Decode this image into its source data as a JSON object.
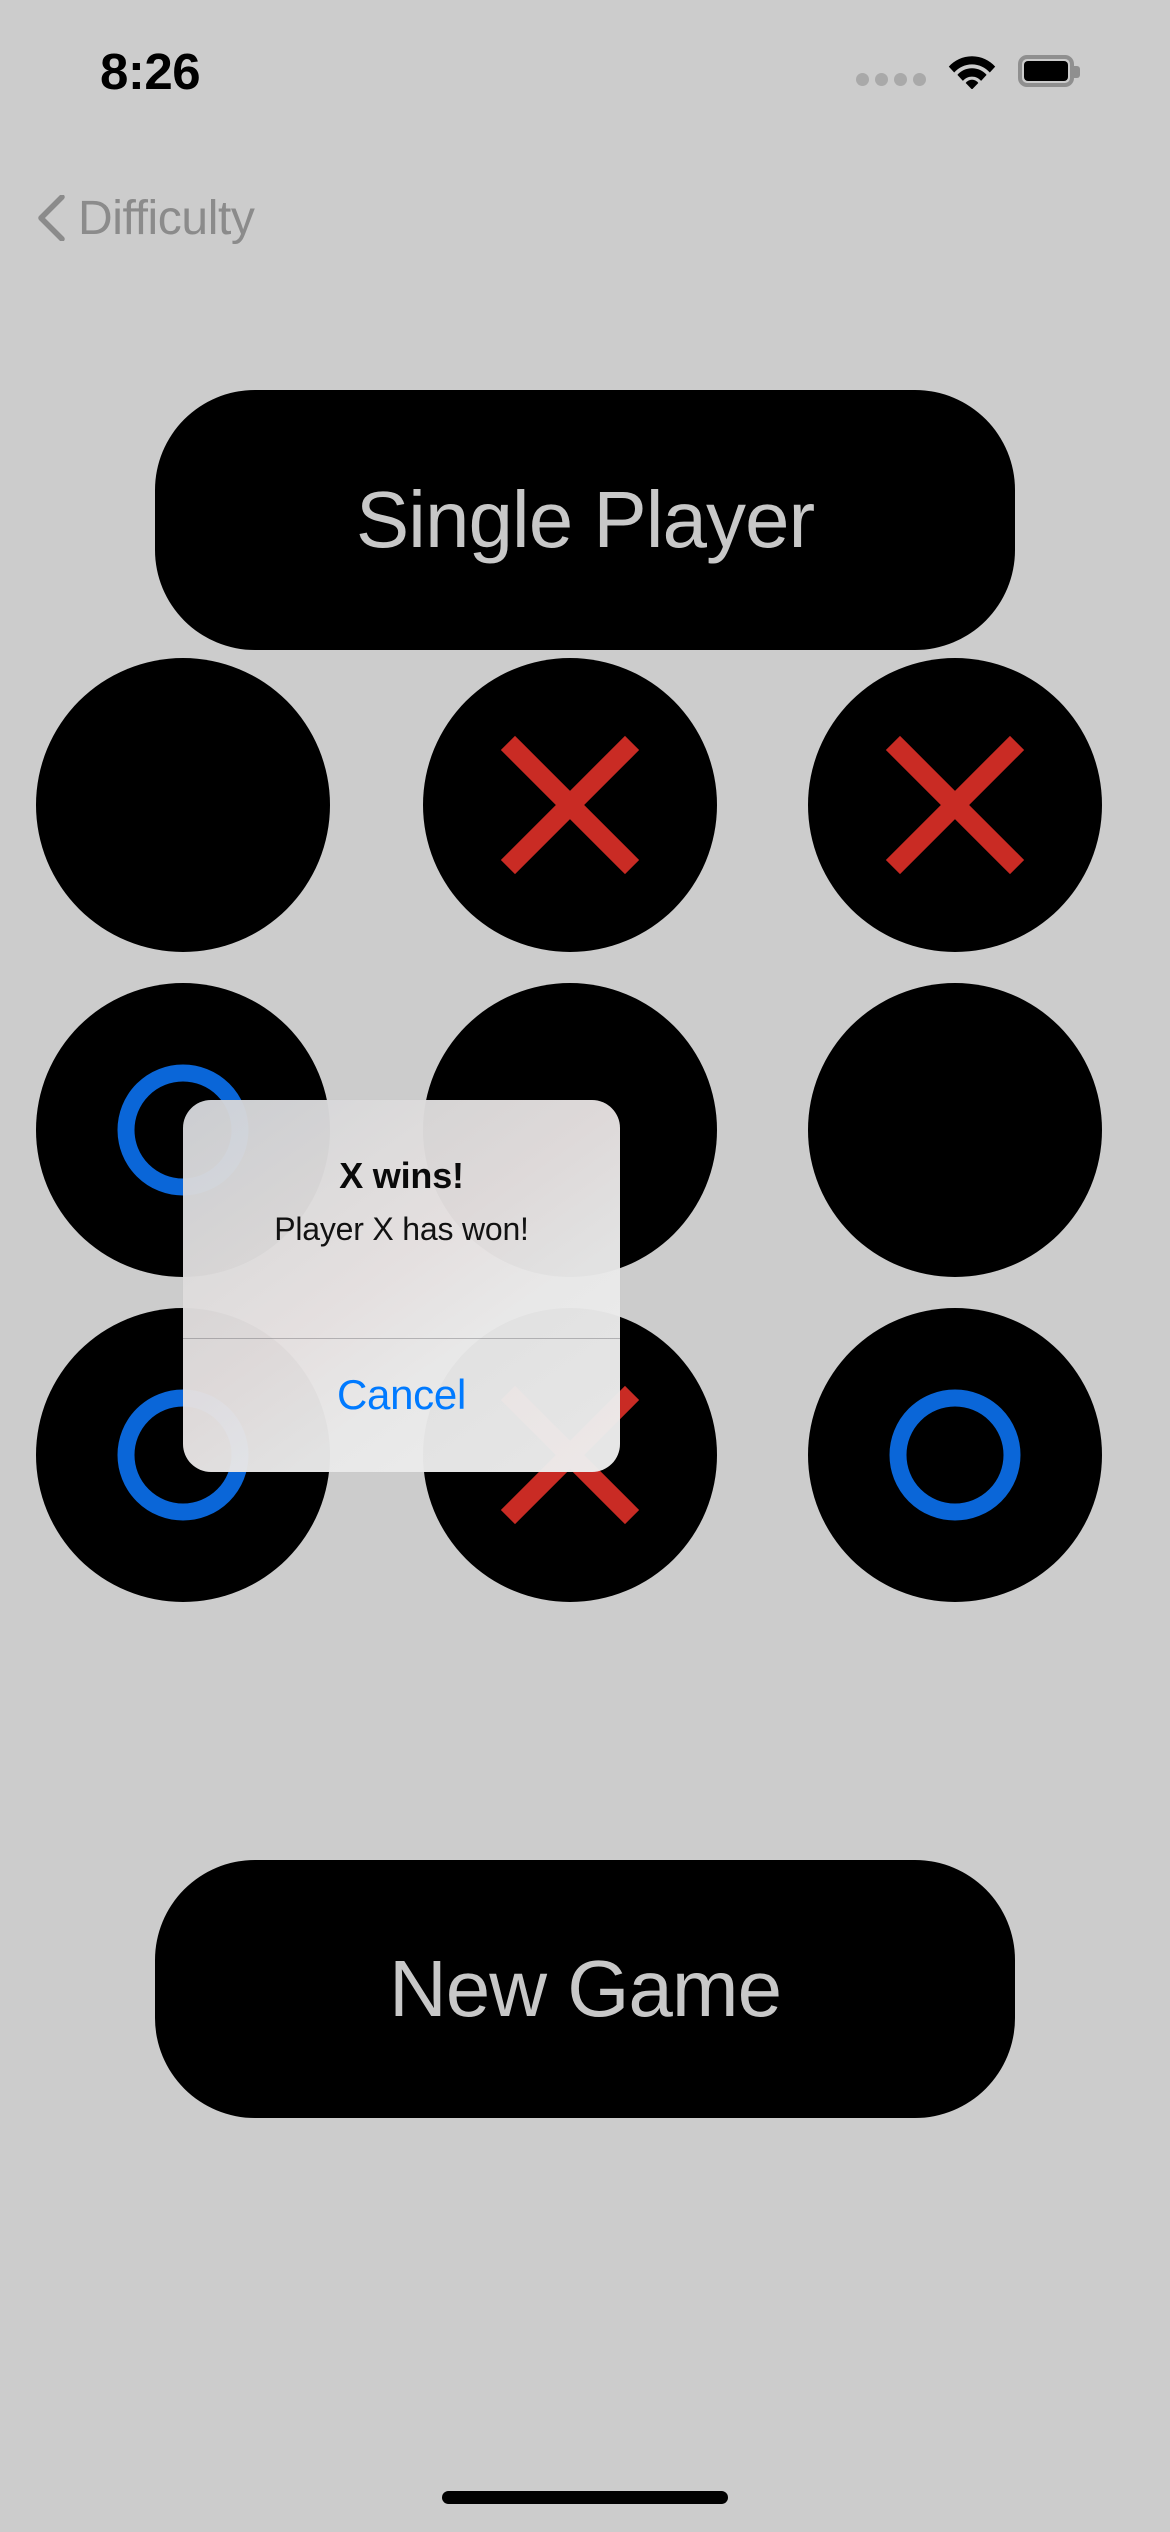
{
  "status_bar": {
    "time": "8:26",
    "cellular_icon": "cellular-dots-icon",
    "cellular_dots": 4,
    "wifi_icon": "wifi-icon",
    "battery_icon": "battery-full-icon"
  },
  "navigation": {
    "back_icon": "chevron-left-icon",
    "back_label": "Difficulty"
  },
  "mode_button": {
    "label": "Single Player"
  },
  "new_game_button": {
    "label": "New Game"
  },
  "board": {
    "rows": [
      {
        "cells": [
          {
            "name": "cell-0-0",
            "mark": ""
          },
          {
            "name": "cell-0-1",
            "mark": "X"
          },
          {
            "name": "cell-0-2",
            "mark": "X"
          }
        ]
      },
      {
        "cells": [
          {
            "name": "cell-1-0",
            "mark": "O"
          },
          {
            "name": "cell-1-1",
            "mark": ""
          },
          {
            "name": "cell-1-2",
            "mark": ""
          }
        ]
      },
      {
        "cells": [
          {
            "name": "cell-2-0",
            "mark": "O"
          },
          {
            "name": "cell-2-1",
            "mark": "X"
          },
          {
            "name": "cell-2-2",
            "mark": "O"
          }
        ]
      }
    ]
  },
  "alert": {
    "title": "X wins!",
    "message": "Player X has won!",
    "cancel_label": "Cancel"
  },
  "home_indicator": {
    "name": "home-indicator-bar"
  },
  "colors": {
    "background": "#cccccc",
    "cell_fill": "#000000",
    "x_mark": "#c92b24",
    "o_mark": "#0a66d8",
    "button_text": "#c8c8c8",
    "back_label": "#8b8b8b",
    "accent_blue": "#007aff"
  }
}
